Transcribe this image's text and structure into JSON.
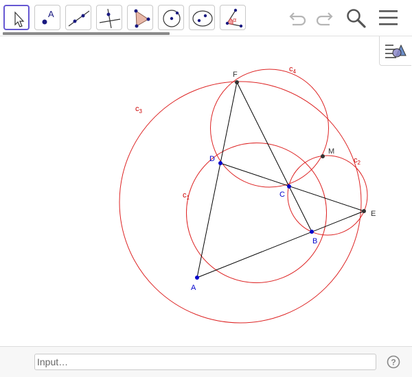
{
  "toolbar": {
    "tools": [
      {
        "name": "move-tool",
        "icon": "cursor-arrow-icon",
        "active": true
      },
      {
        "name": "point-tool",
        "icon": "point-A-icon",
        "label": "A"
      },
      {
        "name": "line-tool",
        "icon": "line-through-points-icon"
      },
      {
        "name": "perpendicular-line-tool",
        "icon": "perpendicular-line-icon"
      },
      {
        "name": "polygon-tool",
        "icon": "polygon-icon"
      },
      {
        "name": "circle-center-point-tool",
        "icon": "circle-center-icon"
      },
      {
        "name": "conic-tool",
        "icon": "ellipse-icon"
      },
      {
        "name": "angle-tool",
        "icon": "angle-icon",
        "label": "α"
      }
    ],
    "right_icons": [
      "undo-icon",
      "redo-icon",
      "search-icon",
      "menu-icon"
    ]
  },
  "colors": {
    "circle": "#dd2222",
    "segment": "#000000",
    "point_blue": "#0000cc",
    "point_dark": "#333333",
    "circle_label": "#cc0000",
    "point_label_blue": "#0000cc",
    "point_label_dark": "#333333",
    "active_tool_border": "#6557d2"
  },
  "construction": {
    "points": [
      {
        "id": "A",
        "label": "A",
        "color": "blue"
      },
      {
        "id": "B",
        "label": "B",
        "color": "blue"
      },
      {
        "id": "C",
        "label": "C",
        "color": "blue"
      },
      {
        "id": "D",
        "label": "D",
        "color": "blue"
      },
      {
        "id": "E",
        "label": "E",
        "color": "dark"
      },
      {
        "id": "F",
        "label": "F",
        "color": "dark"
      },
      {
        "id": "M",
        "label": "M",
        "color": "dark"
      }
    ],
    "circles": [
      {
        "id": "c1",
        "name": "c",
        "sub": "1"
      },
      {
        "id": "c2",
        "name": "c",
        "sub": "2"
      },
      {
        "id": "c3",
        "name": "c",
        "sub": "3"
      },
      {
        "id": "c4",
        "name": "c",
        "sub": "4"
      }
    ]
  },
  "algebra_toggle": {
    "icon": "algebra-view-toggle-icon"
  },
  "input_bar": {
    "placeholder": "Input…",
    "value": ""
  },
  "help": {
    "label": "?",
    "icon": "help-icon"
  }
}
